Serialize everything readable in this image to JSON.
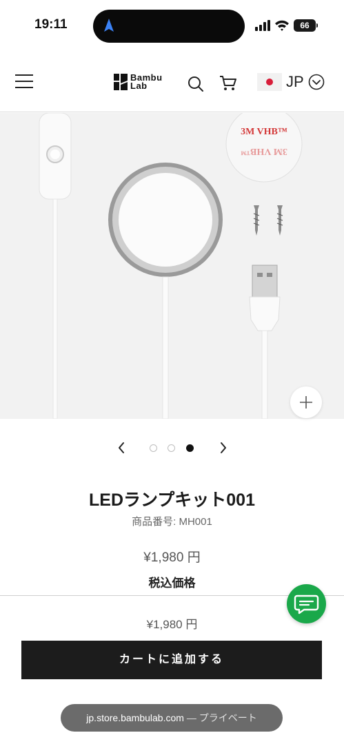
{
  "status_bar": {
    "time": "19:11",
    "battery": "66",
    "icons": [
      "navigation-arrow-icon",
      "signal-icon",
      "wifi-icon",
      "battery-icon"
    ]
  },
  "header": {
    "logo_line1": "Bambu",
    "logo_line2": "Lab",
    "locale": "JP",
    "icons": [
      "menu-icon",
      "bambu-logo-icon",
      "search-icon",
      "cart-icon",
      "japan-flag-icon",
      "chevron-down-icon"
    ]
  },
  "gallery": {
    "tape_text": "3M VHB™",
    "total_images": 3,
    "active_index": 3,
    "icons": [
      "zoom-plus-icon",
      "chevron-left-icon",
      "chevron-right-icon"
    ]
  },
  "product": {
    "title": "LEDランプキット001",
    "sku": "商品番号: MH001",
    "price": "¥1,980 円",
    "tax_label": "税込価格",
    "sticky_price": "¥1,980 円",
    "add_to_cart": "カートに追加する"
  },
  "browser": {
    "domain": "jp.store.bambulab.com",
    "private_label": "— プライベート"
  },
  "colors": {
    "cta_bg": "#1c1c1c",
    "chat_green": "#1aa84a",
    "flag_red": "#d81e3a",
    "nav_blue": "#3b82f6"
  }
}
